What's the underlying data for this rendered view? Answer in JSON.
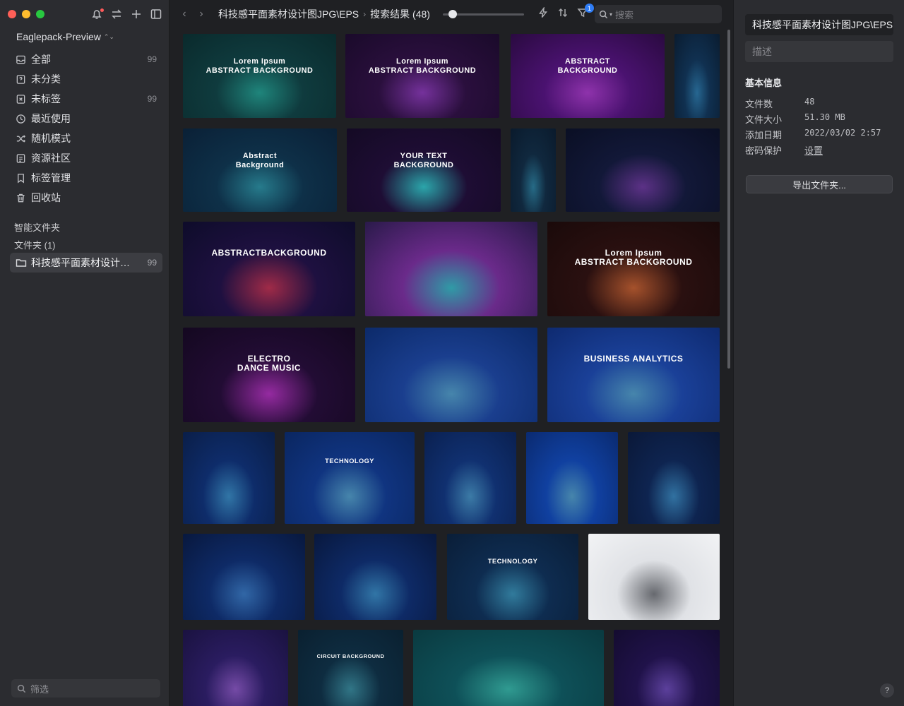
{
  "sidebar": {
    "library_name": "Eaglepack-Preview",
    "items": [
      {
        "label": "全部",
        "count": "99",
        "icon": "inbox-icon"
      },
      {
        "label": "未分类",
        "count": "",
        "icon": "question-box-icon"
      },
      {
        "label": "未标签",
        "count": "99",
        "icon": "tag-off-icon"
      },
      {
        "label": "最近使用",
        "count": "",
        "icon": "clock-icon"
      },
      {
        "label": "随机模式",
        "count": "",
        "icon": "shuffle-icon"
      },
      {
        "label": "资源社区",
        "count": "",
        "icon": "community-icon"
      },
      {
        "label": "标签管理",
        "count": "",
        "icon": "bookmark-icon"
      },
      {
        "label": "回收站",
        "count": "",
        "icon": "trash-icon"
      }
    ],
    "smart_folders_title": "智能文件夹",
    "folders_title": "文件夹 (1)",
    "folder": {
      "label": "科技感平面素材设计图J...",
      "count": "99"
    },
    "filter_placeholder": "筛选"
  },
  "toolbar": {
    "breadcrumb_folder": "科技感平面素材设计图JPG\\EPS",
    "breadcrumb_sep": "›",
    "breadcrumb_result": "搜索结果 (48)",
    "filter_badge": "1",
    "search_placeholder": "搜索",
    "zoom_level": 0.1
  },
  "thumbnails": [
    {
      "caption": "Lorem Ipsum\nABSTRACT BACKGROUND",
      "colors": [
        "#0a2a2c",
        "#0f3b3e",
        "#1fb8a8"
      ]
    },
    {
      "caption": "Lorem Ipsum\nABSTRACT BACKGROUND",
      "colors": [
        "#1a0a2a",
        "#2a0f3d",
        "#a03ad8"
      ]
    },
    {
      "caption": "ABSTRACT\nBACKGROUND",
      "colors": [
        "#2a0a40",
        "#4a1270",
        "#c63cf0"
      ]
    },
    {
      "caption": "",
      "colors": [
        "#0a1c30",
        "#103050",
        "#2a8ac8"
      ]
    },
    {
      "caption": "Abstract\nBackground",
      "colors": [
        "#0a2036",
        "#0e3048",
        "#2aa8c0"
      ]
    },
    {
      "caption": "YOUR TEXT\nBACKGROUND",
      "colors": [
        "#140a24",
        "#1e0d34",
        "#31e8ee"
      ]
    },
    {
      "caption": "",
      "colors": [
        "#0a1a2c",
        "#10283e",
        "#2a90b8"
      ]
    },
    {
      "caption": "",
      "colors": [
        "#0a0f24",
        "#121838",
        "#7a3ab8"
      ]
    },
    {
      "caption": "ABSTRACTBACKGROUND",
      "colors": [
        "#0e0c2a",
        "#1e1040",
        "#e0305a"
      ]
    },
    {
      "caption": "",
      "colors": [
        "#2a1a4a",
        "#6a2a8a",
        "#38d8e8"
      ]
    },
    {
      "caption": "Lorem Ipsum\nABSTRACT BACKGROUND",
      "colors": [
        "#1a0a0a",
        "#2a1010",
        "#e86a30"
      ]
    },
    {
      "caption": "ELECTRO\nDANCE MUSIC",
      "colors": [
        "#140820",
        "#220c34",
        "#d030e0"
      ]
    },
    {
      "caption": "",
      "colors": [
        "#0c2a6a",
        "#1a3e8e",
        "#5ab8f0"
      ]
    },
    {
      "caption": "BUSINESS ANALYTICS",
      "colors": [
        "#0e2a70",
        "#1a4098",
        "#5ab8f0"
      ]
    },
    {
      "caption": "",
      "colors": [
        "#0a1e48",
        "#0e2c6a",
        "#3aa0e8"
      ]
    },
    {
      "caption": "TECHNOLOGY",
      "colors": [
        "#0a2660",
        "#103480",
        "#5ab8f0"
      ]
    },
    {
      "caption": "",
      "colors": [
        "#0a2050",
        "#103070",
        "#4aa8e8"
      ]
    },
    {
      "caption": "",
      "colors": [
        "#0a2a70",
        "#1040a0",
        "#5ab8f0"
      ]
    },
    {
      "caption": "",
      "colors": [
        "#0a1838",
        "#0e2450",
        "#3a9ae0"
      ]
    },
    {
      "caption": "",
      "colors": [
        "#08183e",
        "#0e2a66",
        "#3a8ae8"
      ]
    },
    {
      "caption": "",
      "colors": [
        "#08183e",
        "#0e2a66",
        "#3aa0e8"
      ]
    },
    {
      "caption": "TECHNOLOGY",
      "colors": [
        "#0a1e38",
        "#0e2c50",
        "#3aa8d8"
      ]
    },
    {
      "caption": "",
      "colors": [
        "#f2f3f5",
        "#e0e2e6",
        "#8a8d94"
      ]
    },
    {
      "caption": "",
      "colors": [
        "#1a1240",
        "#2a1c60",
        "#a060e8"
      ]
    },
    {
      "caption": "CIRCUIT BACKGROUND",
      "colors": [
        "#0a2030",
        "#0e2c40",
        "#3aa0b8"
      ]
    },
    {
      "caption": "",
      "colors": [
        "#0a3a40",
        "#0e5058",
        "#38d8c8"
      ]
    },
    {
      "caption": "",
      "colors": [
        "#140c30",
        "#20124a",
        "#7a50d8"
      ]
    }
  ],
  "inspector": {
    "title": "科技感平面素材设计图JPG\\EPS",
    "description_placeholder": "描述",
    "section_title": "基本信息",
    "rows": [
      {
        "key": "文件数",
        "value": "48"
      },
      {
        "key": "文件大小",
        "value": "51.30 MB"
      },
      {
        "key": "添加日期",
        "value": "2022/03/02 2:57"
      },
      {
        "key": "密码保护",
        "value": "设置"
      }
    ],
    "export_label": "导出文件夹...",
    "help_label": "?"
  }
}
